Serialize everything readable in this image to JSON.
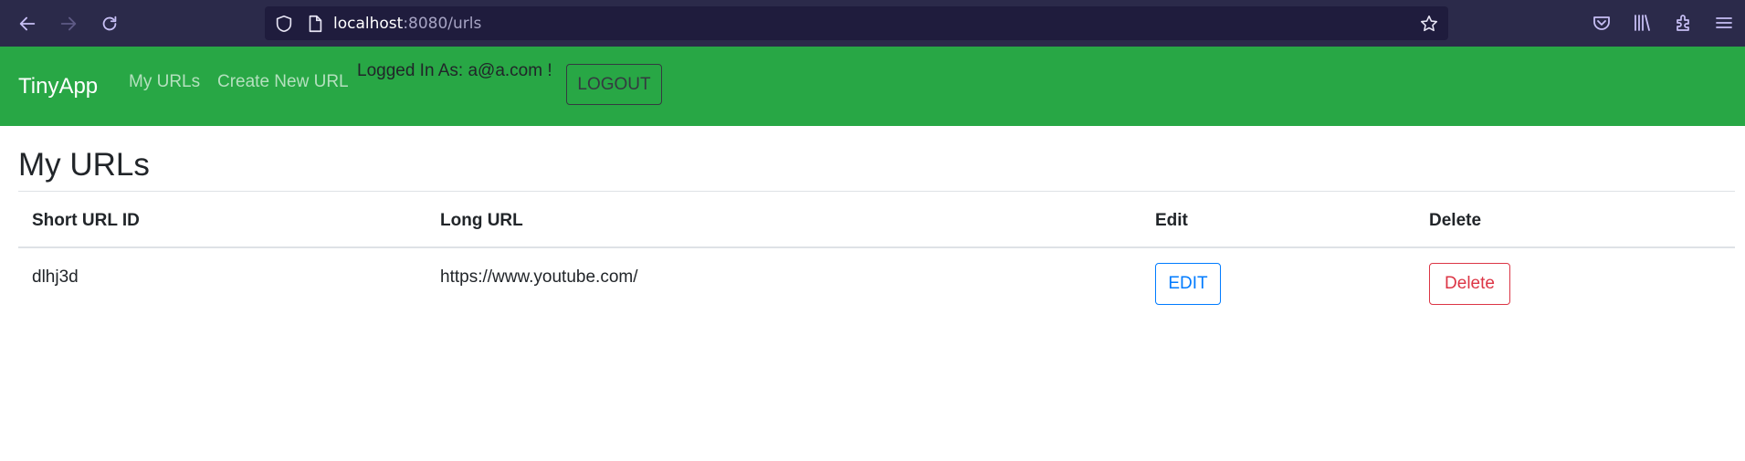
{
  "browser": {
    "url_host": "localhost",
    "url_rest": ":8080/urls"
  },
  "navbar": {
    "brand": "TinyApp",
    "links": [
      "My URLs",
      "Create New URL"
    ],
    "logged_in_text": "Logged In As: a@a.com !",
    "logout_label": "LOGOUT",
    "bg_color": "#28a745"
  },
  "main": {
    "title": "My URLs",
    "table": {
      "headers": [
        "Short URL ID",
        "Long URL",
        "Edit",
        "Delete"
      ],
      "rows": [
        {
          "short_id": "dlhj3d",
          "long_url": "https://www.youtube.com/",
          "edit_label": "EDIT",
          "delete_label": "Delete"
        }
      ]
    }
  },
  "icons": [
    "back-arrow-icon",
    "forward-arrow-icon",
    "reload-icon",
    "shield-icon",
    "page-icon",
    "star-icon",
    "pocket-icon",
    "library-icon",
    "extensions-icon",
    "menu-icon"
  ]
}
